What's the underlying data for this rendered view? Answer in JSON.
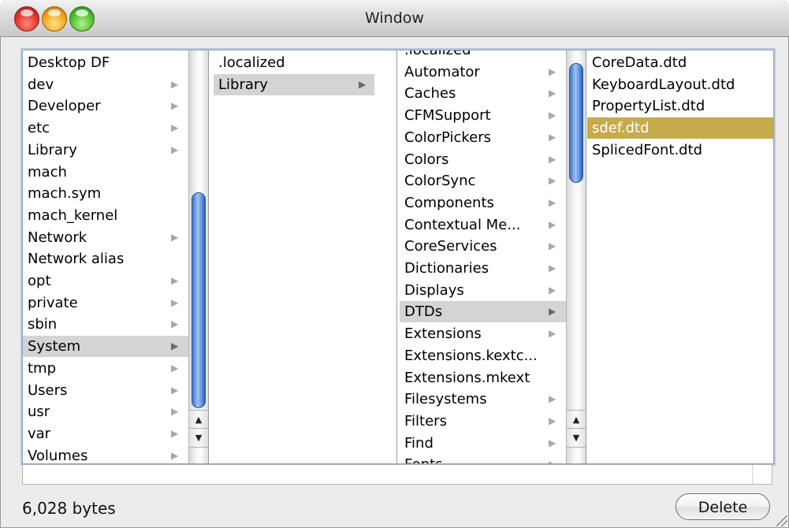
{
  "window": {
    "title": "Window"
  },
  "columns": [
    {
      "items": [
        {
          "label": "Desktop DF",
          "arrow": false
        },
        {
          "label": "dev",
          "arrow": true
        },
        {
          "label": "Developer",
          "arrow": true
        },
        {
          "label": "etc",
          "arrow": true
        },
        {
          "label": "Library",
          "arrow": true
        },
        {
          "label": "mach",
          "arrow": false
        },
        {
          "label": "mach.sym",
          "arrow": false
        },
        {
          "label": "mach_kernel",
          "arrow": false
        },
        {
          "label": "Network",
          "arrow": true
        },
        {
          "label": "Network alias",
          "arrow": false
        },
        {
          "label": "opt",
          "arrow": true
        },
        {
          "label": "private",
          "arrow": true
        },
        {
          "label": "sbin",
          "arrow": true
        },
        {
          "label": "System",
          "arrow": true,
          "selected": true
        },
        {
          "label": "tmp",
          "arrow": true
        },
        {
          "label": "Users",
          "arrow": true
        },
        {
          "label": "usr",
          "arrow": true
        },
        {
          "label": "var",
          "arrow": true
        },
        {
          "label": "Volumes",
          "arrow": true
        }
      ]
    },
    {
      "items": [
        {
          "label": ".localized",
          "arrow": false
        },
        {
          "label": "Library",
          "arrow": true,
          "selected": true
        }
      ]
    },
    {
      "items": [
        {
          "label": ".localized",
          "arrow": false
        },
        {
          "label": "Automator",
          "arrow": true
        },
        {
          "label": "Caches",
          "arrow": true
        },
        {
          "label": "CFMSupport",
          "arrow": true
        },
        {
          "label": "ColorPickers",
          "arrow": true
        },
        {
          "label": "Colors",
          "arrow": true
        },
        {
          "label": "ColorSync",
          "arrow": true
        },
        {
          "label": "Components",
          "arrow": true
        },
        {
          "label": "Contextual Me...",
          "arrow": true
        },
        {
          "label": "CoreServices",
          "arrow": true
        },
        {
          "label": "Dictionaries",
          "arrow": true
        },
        {
          "label": "Displays",
          "arrow": true
        },
        {
          "label": "DTDs",
          "arrow": true,
          "selected": true
        },
        {
          "label": "Extensions",
          "arrow": true
        },
        {
          "label": "Extensions.kextc...",
          "arrow": false
        },
        {
          "label": "Extensions.mkext",
          "arrow": false
        },
        {
          "label": "Filesystems",
          "arrow": true
        },
        {
          "label": "Filters",
          "arrow": true
        },
        {
          "label": "Find",
          "arrow": true
        },
        {
          "label": "Fonts",
          "arrow": true
        }
      ]
    },
    {
      "items": [
        {
          "label": "CoreData.dtd",
          "arrow": false
        },
        {
          "label": "KeyboardLayout.dtd",
          "arrow": false
        },
        {
          "label": "PropertyList.dtd",
          "arrow": false
        },
        {
          "label": "sdef.dtd",
          "arrow": false,
          "highlighted": true
        },
        {
          "label": "SplicedFont.dtd",
          "arrow": false
        }
      ]
    }
  ],
  "status": {
    "size_text": "6,028 bytes"
  },
  "buttons": {
    "delete_label": "Delete"
  },
  "icons": {
    "arrow": "▶",
    "scroll_up": "▲",
    "scroll_down": "▼"
  },
  "colors": {
    "selection_gray": "#d4d4d4",
    "highlight_gold": "#c6ab4c",
    "scroll_thumb": "#5f93df"
  }
}
